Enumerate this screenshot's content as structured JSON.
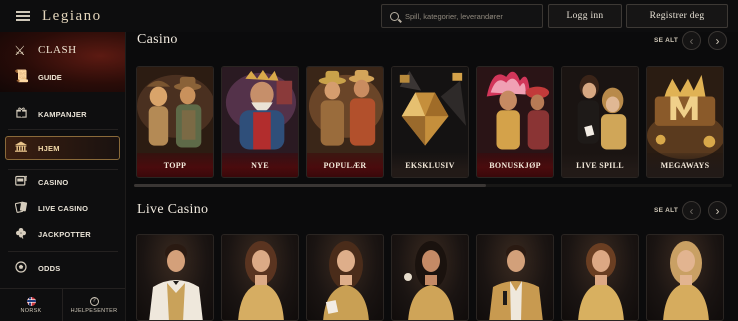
{
  "header": {
    "logo": "Legiano",
    "search_placeholder": "Spill, kategorier, leverandører",
    "login_label": "Logg inn",
    "register_label": "Registrer deg"
  },
  "sidebar": {
    "promo": {
      "title": "Clash",
      "subtitle": "Guide"
    },
    "items": [
      {
        "label": "Kampanjer",
        "icon": "gift-icon"
      },
      {
        "label": "Hjem",
        "icon": "casino-building-icon",
        "active": true
      },
      {
        "label": "Casino",
        "icon": "slot-machine-icon"
      },
      {
        "label": "Live Casino",
        "icon": "cards-icon"
      },
      {
        "label": "Jackpotter",
        "icon": "clover-icon"
      },
      {
        "label": "Odds",
        "icon": "ball-icon"
      }
    ],
    "footer": {
      "language": "Norsk",
      "help": "Hjelpesenter"
    }
  },
  "main": {
    "casino": {
      "title": "Casino",
      "see_all": "SE ALT",
      "tiles": [
        "TOPP",
        "NYE",
        "POPULÆR",
        "EKSKLUSIV",
        "BONUSKJØP",
        "LIVE SPILL",
        "MEGAWAYS"
      ]
    },
    "live_casino": {
      "title": "Live Casino",
      "see_all": "SE ALT"
    }
  },
  "colors": {
    "background": "#0b0b0c",
    "accent_gold": "#d4a558",
    "tile_label_red": "#4a0b0d",
    "promo_red": "#5c1a12"
  }
}
